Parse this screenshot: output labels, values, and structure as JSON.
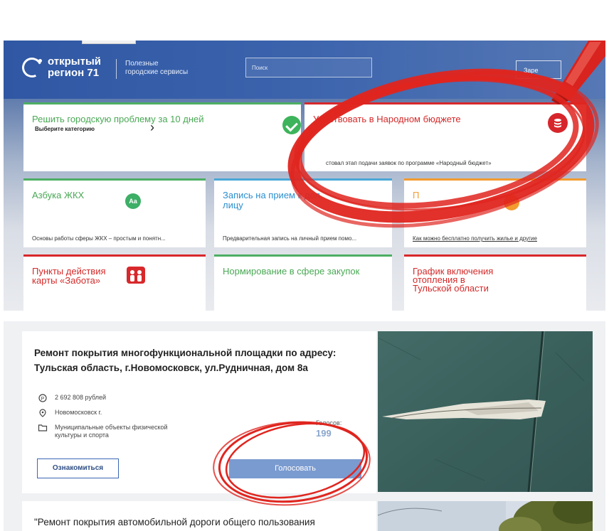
{
  "header": {
    "logo_line1": "открытый",
    "logo_line2": "регион 71",
    "tagline_line1": "Полезные",
    "tagline_line2": "городские сервисы",
    "search_placeholder": "Поиск",
    "register_label": "Заре"
  },
  "cards": {
    "problem": {
      "title": "Решить городскую проблему за 10 дней",
      "select_label": "Выберите категорию",
      "arrow": "›"
    },
    "budget": {
      "title": "Участвовать в Народном бюджете",
      "desc": "стовал этап подачи заявок по программе «Народный бюджет»"
    },
    "abc": {
      "title": "Азбука ЖКХ",
      "icon_text": "Aa",
      "desc": "Основы работы сферы ЖКХ – простым и понятн..."
    },
    "appointment": {
      "title_line1": "Запись на прием к дол",
      "title_line2": "лицу",
      "desc": "Предварительная запись на личный прием помо..."
    },
    "housing": {
      "title": "П",
      "desc": "Как можно бесплатно получить жилье и другие"
    },
    "care": {
      "title_line1": "Пункты действия",
      "title_line2": "карты «Забота»"
    },
    "procurement": {
      "title": "Нормирование в сфере закупок"
    },
    "heating": {
      "title_line1": "График включения",
      "title_line2": "отопления в",
      "title_line3": "Тульской области"
    }
  },
  "project": {
    "title_line1": "Ремонт покрытия многофункциональной площадки по адресу:",
    "title_line2": "Тульская область, г.Новомосковск, ул.Рудничная, дом 8а",
    "amount": "2 692 808 рублей",
    "location": "Новомосковск г.",
    "category_line1": "Муниципальные объекты физической",
    "category_line2": "культуры и спорта",
    "votes_label": "Голосов:",
    "votes_count": "199",
    "details_button": "Ознакомиться",
    "vote_button": "Голосовать"
  },
  "project2": {
    "title": "\"Ремонт покрытия автомобильной дороги общего пользования"
  },
  "colors": {
    "header_blue": "#2f57a3",
    "green": "#4cae63",
    "red": "#d8282b",
    "blue": "#49a7d6",
    "orange": "#f39b2f",
    "vote_button": "#7a9bd0",
    "annotation_red": "#e0251f"
  }
}
